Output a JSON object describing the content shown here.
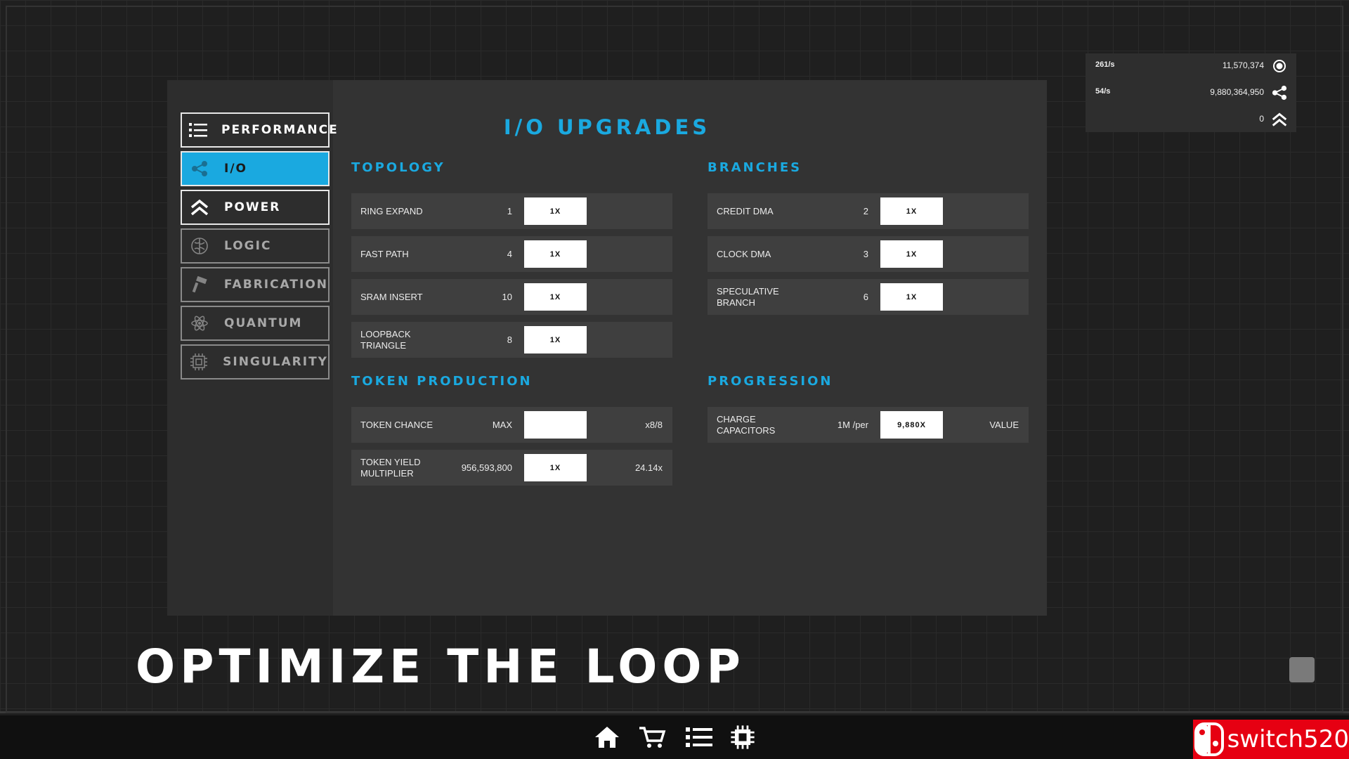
{
  "nav": [
    {
      "label": "PERFORMANCE",
      "icon": "list-icon",
      "state": "active-white"
    },
    {
      "label": "I/O",
      "icon": "share-icon",
      "state": "selected"
    },
    {
      "label": "POWER",
      "icon": "double-chevron-up-icon",
      "state": "active-white"
    },
    {
      "label": "LOGIC",
      "icon": "brain-icon",
      "state": "dim"
    },
    {
      "label": "FABRICATION",
      "icon": "hammer-icon",
      "state": "dim"
    },
    {
      "label": "QUANTUM",
      "icon": "atom-icon",
      "state": "dim"
    },
    {
      "label": "SINGULARITY",
      "icon": "chip-icon",
      "state": "dim"
    }
  ],
  "panel_title": "I/O UPGRADES",
  "sections": {
    "topology": {
      "title": "TOPOLOGY",
      "rows": [
        {
          "label": "RING EXPAND",
          "value": "1",
          "button": "1X",
          "extra": ""
        },
        {
          "label": "FAST PATH",
          "value": "4",
          "button": "1X",
          "extra": ""
        },
        {
          "label": "SRAM INSERT",
          "value": "10",
          "button": "1X",
          "extra": ""
        },
        {
          "label": "LOOPBACK TRIANGLE",
          "value": "8",
          "button": "1X",
          "extra": ""
        }
      ]
    },
    "branches": {
      "title": "BRANCHES",
      "rows": [
        {
          "label": "CREDIT DMA",
          "value": "2",
          "button": "1X",
          "extra": ""
        },
        {
          "label": "CLOCK DMA",
          "value": "3",
          "button": "1X",
          "extra": ""
        },
        {
          "label": "SPECULATIVE BRANCH",
          "value": "6",
          "button": "1X",
          "extra": ""
        }
      ]
    },
    "token_production": {
      "title": "TOKEN PRODUCTION",
      "rows": [
        {
          "label": "TOKEN CHANCE",
          "value": "MAX",
          "button": "",
          "extra": "x8/8"
        },
        {
          "label": "TOKEN YIELD MULTIPLIER",
          "value": "956,593,800",
          "button": "1X",
          "extra": "24.14x"
        }
      ]
    },
    "progression": {
      "title": "PROGRESSION",
      "rows": [
        {
          "label": "CHARGE CAPACITORS",
          "value": "1M /per",
          "button": "9,880X",
          "extra": "VALUE"
        }
      ]
    }
  },
  "stats": [
    {
      "rate": "261/s",
      "amount": "11,570,374",
      "icon": "coin-icon"
    },
    {
      "rate": "54/s",
      "amount": "9,880,364,950",
      "icon": "share-icon"
    },
    {
      "rate": "",
      "amount": "0",
      "icon": "double-chevron-up-icon"
    }
  ],
  "tagline": "OPTIMIZE THE LOOP",
  "bottom_bar": [
    "home-icon",
    "cart-icon",
    "list-icon",
    "chip-icon"
  ],
  "brand": {
    "text": "switch520",
    "color": "#e60012"
  },
  "colors": {
    "accent": "#1aa9e0",
    "panel": "#333333",
    "row": "#3f3f3f"
  }
}
